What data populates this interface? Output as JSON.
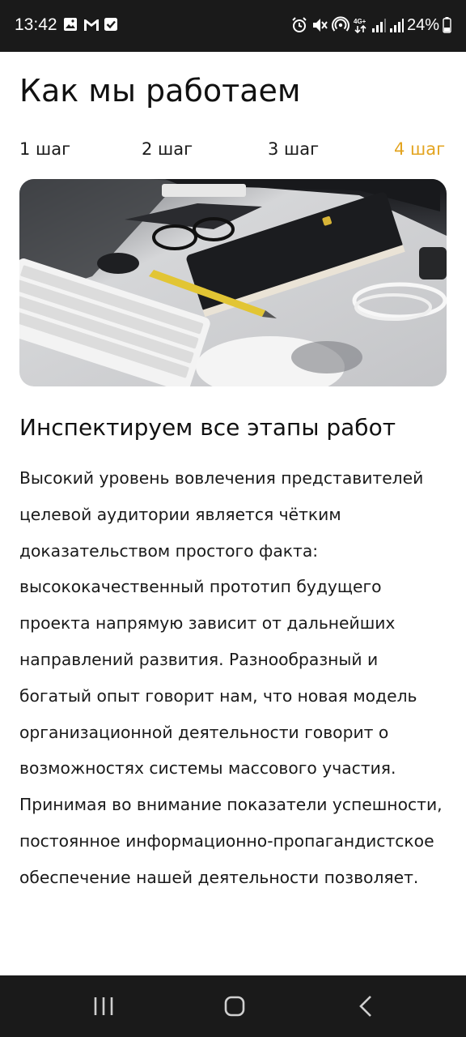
{
  "status_bar": {
    "time": "13:42",
    "battery_percent": "24%",
    "network_label": "4G+",
    "left_icons": [
      "image-icon",
      "gmail-icon",
      "check-box-icon"
    ],
    "right_icons": [
      "alarm-icon",
      "mute-icon",
      "hotspot-icon",
      "network-4g-icon",
      "signal-icon",
      "signal-icon",
      "battery-icon"
    ]
  },
  "page": {
    "title": "Как мы работаем",
    "tabs": [
      {
        "label": "1 шаг",
        "active": false
      },
      {
        "label": "2 шаг",
        "active": false
      },
      {
        "label": "3 шаг",
        "active": false
      },
      {
        "label": "4 шаг",
        "active": true
      }
    ],
    "hero_image": "desk-with-keyboard-notebook-glasses",
    "section_heading": "Инспектируем все этапы работ",
    "body": "Высокий уровень вовлечения представителей целевой аудитории является чётким доказательством простого факта: высококачественный прототип будущего проекта напрямую зависит от дальнейших направлений развития. Разнообразный и богатый опыт говорит нам, что новая модель организационной деятельности говорит о возможностях системы массового участия. Принимая во внимание показатели успешности, постоянное информационно-пропагандистское обеспечение нашей деятельности позволяет."
  },
  "nav_bar": {
    "buttons": [
      "recent-apps-icon",
      "home-icon",
      "back-icon"
    ]
  },
  "colors": {
    "accent": "#e3a420",
    "text": "#1a1a1a",
    "system_bar": "#1a1a1a",
    "background": "#ffffff"
  }
}
